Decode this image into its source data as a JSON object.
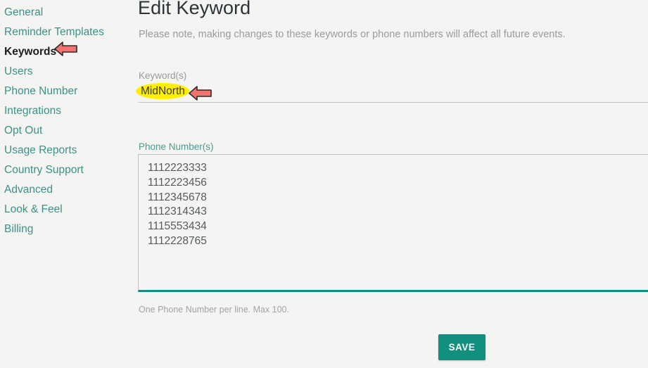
{
  "sidebar": {
    "items": [
      {
        "label": "General",
        "active": false
      },
      {
        "label": "Reminder Templates",
        "active": false
      },
      {
        "label": "Keywords",
        "active": true
      },
      {
        "label": "Users",
        "active": false
      },
      {
        "label": "Phone Number",
        "active": false
      },
      {
        "label": "Integrations",
        "active": false
      },
      {
        "label": "Opt Out",
        "active": false
      },
      {
        "label": "Usage Reports",
        "active": false
      },
      {
        "label": "Country Support",
        "active": false
      },
      {
        "label": "Advanced",
        "active": false
      },
      {
        "label": "Look & Feel",
        "active": false
      },
      {
        "label": "Billing",
        "active": false
      }
    ]
  },
  "main": {
    "title": "Edit Keyword",
    "note": "Please note, making changes to these keywords or phone numbers will affect all future events.",
    "keyword_field": {
      "label": "Keyword(s)",
      "value": "MidNorth",
      "placeholder": "",
      "highlighted": true
    },
    "phone_field": {
      "label": "Phone Number(s)",
      "value": "1112223333\n1112223456\n1112345678\n1112314343\n1115553434\n1112228765",
      "placeholder": "",
      "lines": [
        "1112223333",
        "1112223456",
        "1112345678",
        "1112314343",
        "1115553434",
        "1112228765"
      ],
      "help_text": "One Phone Number per line. Max 100."
    },
    "save_label": "SAVE"
  },
  "annotations": {
    "arrow_keywords": "left-arrow-icon",
    "arrow_keyword_value": "left-arrow-icon",
    "highlight_color": "#ffef00",
    "arrow_color": "#f4736f"
  },
  "colors": {
    "accent": "#12907f",
    "link": "#3b9186",
    "background": "#f4f5f3",
    "title": "#2b3338",
    "muted_text": "#9a9a9a"
  }
}
